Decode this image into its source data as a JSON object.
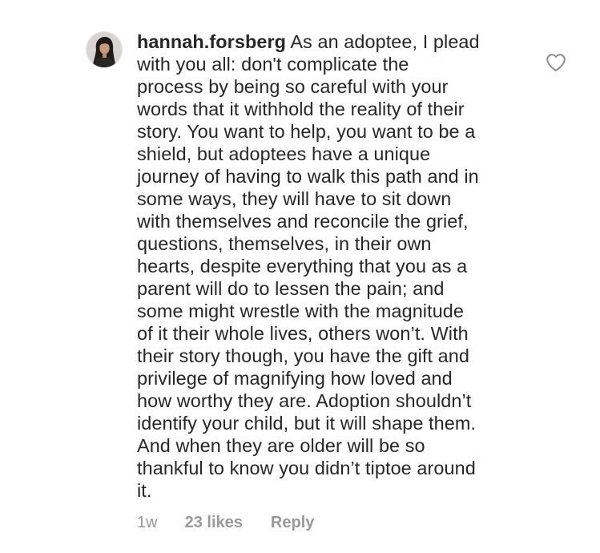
{
  "comment": {
    "username": "hannah.forsberg",
    "text_lines": [
      "As an adoptee, I plead",
      "with you all: don't complicate the",
      "process by being so careful with your",
      "words that it withhold the reality of their",
      "story. You want to help, you want to be a",
      "shield, but adoptees have a unique",
      "journey of having to walk this path and in",
      "some ways, they will have to sit down",
      "with themselves and reconcile the grief,",
      "questions, themselves, in their own",
      "hearts, despite everything that you as a",
      "parent will do to lessen the pain; and",
      "some might wrestle with the magnitude",
      "of it their whole lives, others won’t. With",
      "their story though, you have the gift and",
      "privilege of magnifying how loved and",
      "how worthy they are. Adoption shouldn’t",
      "identify your child, but it will shape them.",
      "And when they are older will be so",
      "thankful to know you didn’t tiptoe around",
      "it."
    ],
    "avatar_icon": "user-avatar",
    "like_icon": "heart-outline-icon",
    "timestamp": "1w",
    "likes": "23 likes",
    "reply_label": "Reply"
  },
  "colors": {
    "text": "#262626",
    "meta": "#999999",
    "icon": "#8e8e8e"
  }
}
